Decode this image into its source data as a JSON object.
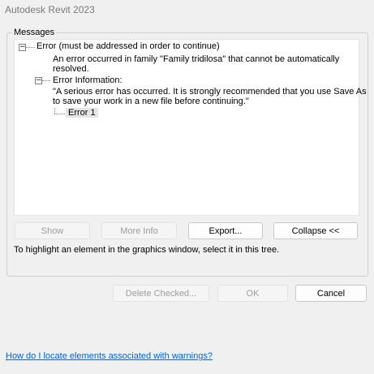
{
  "window": {
    "title": "Autodesk Revit 2023"
  },
  "messages": {
    "group_label": "Messages",
    "tree": {
      "root_label": "Error (must be addressed in order to continue)",
      "description_line1": "An error occurred in family \"Family tridilosa\" that cannot be automatically",
      "description_line2": "resolved.",
      "info_label": "Error Information:",
      "info_text_line1": "\"A serious error has occurred. It is strongly recommended that you use Save As",
      "info_text_line2": "to save your work in a new file before continuing.\"",
      "leaf_label": "Error 1",
      "expand_symbol": "−"
    }
  },
  "buttons": {
    "show": "Show",
    "more_info": "More Info",
    "export": "Export...",
    "collapse": "Collapse <<",
    "delete_checked": "Delete Checked...",
    "ok": "OK",
    "cancel": "Cancel"
  },
  "hint": "To highlight an element in the graphics window, select it in this tree.",
  "help_link": "How do I locate elements associated with warnings?"
}
